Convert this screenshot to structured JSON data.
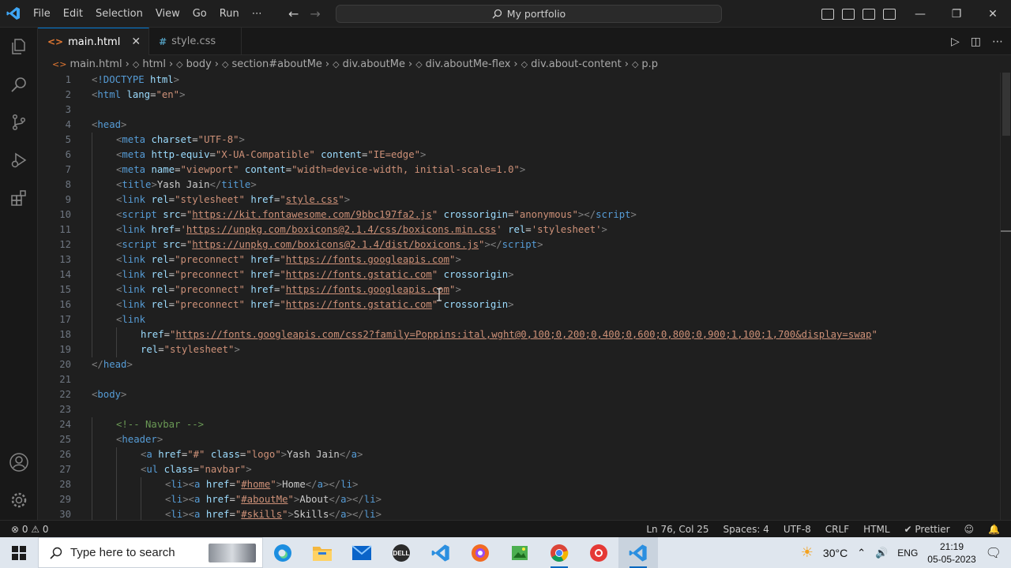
{
  "titlebar": {
    "menu": [
      "File",
      "Edit",
      "Selection",
      "View",
      "Go",
      "Run",
      "⋯"
    ],
    "command_center": "My portfolio",
    "window_controls": [
      "—",
      "❐",
      "✕"
    ]
  },
  "tabs": [
    {
      "label": "main.html",
      "icon": "html-file-icon",
      "active": true,
      "icon_glyph": "<>"
    },
    {
      "label": "style.css",
      "icon": "css-file-icon",
      "active": false,
      "icon_glyph": "#"
    }
  ],
  "breadcrumb": [
    "main.html",
    "html",
    "body",
    "section#aboutMe",
    "div.aboutMe",
    "div.aboutMe-flex",
    "div.about-content",
    "p.p"
  ],
  "code": {
    "lines": [
      {
        "n": "1",
        "indent": 0,
        "tokens": [
          [
            "br",
            "<"
          ],
          [
            "tag",
            "!DOCTYPE"
          ],
          [
            "txt",
            " "
          ],
          [
            "attr",
            "html"
          ],
          [
            "br",
            ">"
          ]
        ]
      },
      {
        "n": "2",
        "indent": 0,
        "tokens": [
          [
            "br",
            "<"
          ],
          [
            "tag",
            "html"
          ],
          [
            "txt",
            " "
          ],
          [
            "attr",
            "lang"
          ],
          [
            "eq",
            "="
          ],
          [
            "str",
            "\"en\""
          ],
          [
            "br",
            ">"
          ]
        ]
      },
      {
        "n": "3",
        "indent": 0,
        "tokens": []
      },
      {
        "n": "4",
        "indent": 0,
        "tokens": [
          [
            "br",
            "<"
          ],
          [
            "tag",
            "head"
          ],
          [
            "br",
            ">"
          ]
        ]
      },
      {
        "n": "5",
        "indent": 1,
        "tokens": [
          [
            "br",
            "<"
          ],
          [
            "tag",
            "meta"
          ],
          [
            "txt",
            " "
          ],
          [
            "attr",
            "charset"
          ],
          [
            "eq",
            "="
          ],
          [
            "str",
            "\"UTF-8\""
          ],
          [
            "br",
            ">"
          ]
        ]
      },
      {
        "n": "6",
        "indent": 1,
        "tokens": [
          [
            "br",
            "<"
          ],
          [
            "tag",
            "meta"
          ],
          [
            "txt",
            " "
          ],
          [
            "attr",
            "http-equiv"
          ],
          [
            "eq",
            "="
          ],
          [
            "str",
            "\"X-UA-Compatible\""
          ],
          [
            "txt",
            " "
          ],
          [
            "attr",
            "content"
          ],
          [
            "eq",
            "="
          ],
          [
            "str",
            "\"IE=edge\""
          ],
          [
            "br",
            ">"
          ]
        ]
      },
      {
        "n": "7",
        "indent": 1,
        "tokens": [
          [
            "br",
            "<"
          ],
          [
            "tag",
            "meta"
          ],
          [
            "txt",
            " "
          ],
          [
            "attr",
            "name"
          ],
          [
            "eq",
            "="
          ],
          [
            "str",
            "\"viewport\""
          ],
          [
            "txt",
            " "
          ],
          [
            "attr",
            "content"
          ],
          [
            "eq",
            "="
          ],
          [
            "str",
            "\"width=device-width, initial-scale=1.0\""
          ],
          [
            "br",
            ">"
          ]
        ]
      },
      {
        "n": "8",
        "indent": 1,
        "tokens": [
          [
            "br",
            "<"
          ],
          [
            "tag",
            "title"
          ],
          [
            "br",
            ">"
          ],
          [
            "txt",
            "Yash Jain"
          ],
          [
            "br",
            "</"
          ],
          [
            "tag",
            "title"
          ],
          [
            "br",
            ">"
          ]
        ]
      },
      {
        "n": "9",
        "indent": 1,
        "tokens": [
          [
            "br",
            "<"
          ],
          [
            "tag",
            "link"
          ],
          [
            "txt",
            " "
          ],
          [
            "attr",
            "rel"
          ],
          [
            "eq",
            "="
          ],
          [
            "str",
            "\"stylesheet\""
          ],
          [
            "txt",
            " "
          ],
          [
            "attr",
            "href"
          ],
          [
            "eq",
            "="
          ],
          [
            "str",
            "\""
          ],
          [
            "strlink",
            "style.css"
          ],
          [
            "str",
            "\""
          ],
          [
            "br",
            ">"
          ]
        ]
      },
      {
        "n": "10",
        "indent": 1,
        "tokens": [
          [
            "br",
            "<"
          ],
          [
            "tag",
            "script"
          ],
          [
            "txt",
            " "
          ],
          [
            "attr",
            "src"
          ],
          [
            "eq",
            "="
          ],
          [
            "str",
            "\""
          ],
          [
            "strlink",
            "https://kit.fontawesome.com/9bbc197fa2.js"
          ],
          [
            "str",
            "\""
          ],
          [
            "txt",
            " "
          ],
          [
            "attr",
            "crossorigin"
          ],
          [
            "eq",
            "="
          ],
          [
            "str",
            "\"anonymous\""
          ],
          [
            "br",
            "></"
          ],
          [
            "tag",
            "script"
          ],
          [
            "br",
            ">"
          ]
        ]
      },
      {
        "n": "11",
        "indent": 1,
        "tokens": [
          [
            "br",
            "<"
          ],
          [
            "tag",
            "link"
          ],
          [
            "txt",
            " "
          ],
          [
            "attr",
            "href"
          ],
          [
            "eq",
            "="
          ],
          [
            "str",
            "'"
          ],
          [
            "strlink",
            "https://unpkg.com/boxicons@2.1.4/css/boxicons.min.css"
          ],
          [
            "str",
            "'"
          ],
          [
            "txt",
            " "
          ],
          [
            "attr",
            "rel"
          ],
          [
            "eq",
            "="
          ],
          [
            "str",
            "'stylesheet'"
          ],
          [
            "br",
            ">"
          ]
        ]
      },
      {
        "n": "12",
        "indent": 1,
        "tokens": [
          [
            "br",
            "<"
          ],
          [
            "tag",
            "script"
          ],
          [
            "txt",
            " "
          ],
          [
            "attr",
            "src"
          ],
          [
            "eq",
            "="
          ],
          [
            "str",
            "\""
          ],
          [
            "strlink",
            "https://unpkg.com/boxicons@2.1.4/dist/boxicons.js"
          ],
          [
            "str",
            "\""
          ],
          [
            "br",
            "></"
          ],
          [
            "tag",
            "script"
          ],
          [
            "br",
            ">"
          ]
        ]
      },
      {
        "n": "13",
        "indent": 1,
        "tokens": [
          [
            "br",
            "<"
          ],
          [
            "tag",
            "link"
          ],
          [
            "txt",
            " "
          ],
          [
            "attr",
            "rel"
          ],
          [
            "eq",
            "="
          ],
          [
            "str",
            "\"preconnect\""
          ],
          [
            "txt",
            " "
          ],
          [
            "attr",
            "href"
          ],
          [
            "eq",
            "="
          ],
          [
            "str",
            "\""
          ],
          [
            "strlink",
            "https://fonts.googleapis.com"
          ],
          [
            "str",
            "\""
          ],
          [
            "br",
            ">"
          ]
        ]
      },
      {
        "n": "14",
        "indent": 1,
        "tokens": [
          [
            "br",
            "<"
          ],
          [
            "tag",
            "link"
          ],
          [
            "txt",
            " "
          ],
          [
            "attr",
            "rel"
          ],
          [
            "eq",
            "="
          ],
          [
            "str",
            "\"preconnect\""
          ],
          [
            "txt",
            " "
          ],
          [
            "attr",
            "href"
          ],
          [
            "eq",
            "="
          ],
          [
            "str",
            "\""
          ],
          [
            "strlink",
            "https://fonts.gstatic.com"
          ],
          [
            "str",
            "\""
          ],
          [
            "txt",
            " "
          ],
          [
            "attr",
            "crossorigin"
          ],
          [
            "br",
            ">"
          ]
        ]
      },
      {
        "n": "15",
        "indent": 1,
        "tokens": [
          [
            "br",
            "<"
          ],
          [
            "tag",
            "link"
          ],
          [
            "txt",
            " "
          ],
          [
            "attr",
            "rel"
          ],
          [
            "eq",
            "="
          ],
          [
            "str",
            "\"preconnect\""
          ],
          [
            "txt",
            " "
          ],
          [
            "attr",
            "href"
          ],
          [
            "eq",
            "="
          ],
          [
            "str",
            "\""
          ],
          [
            "strlink",
            "https://fonts.googleapis.com"
          ],
          [
            "str",
            "\""
          ],
          [
            "br",
            ">"
          ]
        ]
      },
      {
        "n": "16",
        "indent": 1,
        "tokens": [
          [
            "br",
            "<"
          ],
          [
            "tag",
            "link"
          ],
          [
            "txt",
            " "
          ],
          [
            "attr",
            "rel"
          ],
          [
            "eq",
            "="
          ],
          [
            "str",
            "\"preconnect\""
          ],
          [
            "txt",
            " "
          ],
          [
            "attr",
            "href"
          ],
          [
            "eq",
            "="
          ],
          [
            "str",
            "\""
          ],
          [
            "strlink",
            "https://fonts.gstatic.com"
          ],
          [
            "str",
            "\""
          ],
          [
            "txt",
            " "
          ],
          [
            "attr",
            "crossorigin"
          ],
          [
            "br",
            ">"
          ]
        ]
      },
      {
        "n": "17",
        "indent": 1,
        "tokens": [
          [
            "br",
            "<"
          ],
          [
            "tag",
            "link"
          ]
        ]
      },
      {
        "n": "18",
        "indent": 2,
        "tokens": [
          [
            "attr",
            "href"
          ],
          [
            "eq",
            "="
          ],
          [
            "str",
            "\""
          ],
          [
            "strlink",
            "https://fonts.googleapis.com/css2?family=Poppins:ital,wght@0,100;0,200;0,400;0,600;0,800;0,900;1,100;1,700&display=swap"
          ],
          [
            "str",
            "\""
          ]
        ]
      },
      {
        "n": "19",
        "indent": 2,
        "tokens": [
          [
            "attr",
            "rel"
          ],
          [
            "eq",
            "="
          ],
          [
            "str",
            "\"stylesheet\""
          ],
          [
            "br",
            ">"
          ]
        ]
      },
      {
        "n": "20",
        "indent": 0,
        "tokens": [
          [
            "br",
            "</"
          ],
          [
            "tag",
            "head"
          ],
          [
            "br",
            ">"
          ]
        ]
      },
      {
        "n": "21",
        "indent": 0,
        "tokens": []
      },
      {
        "n": "22",
        "indent": 0,
        "tokens": [
          [
            "br",
            "<"
          ],
          [
            "tag",
            "body"
          ],
          [
            "br",
            ">"
          ]
        ]
      },
      {
        "n": "23",
        "indent": 0,
        "tokens": []
      },
      {
        "n": "24",
        "indent": 1,
        "tokens": [
          [
            "com",
            "<!-- Navbar -->"
          ]
        ]
      },
      {
        "n": "25",
        "indent": 1,
        "tokens": [
          [
            "br",
            "<"
          ],
          [
            "tag",
            "header"
          ],
          [
            "br",
            ">"
          ]
        ]
      },
      {
        "n": "26",
        "indent": 2,
        "tokens": [
          [
            "br",
            "<"
          ],
          [
            "tag",
            "a"
          ],
          [
            "txt",
            " "
          ],
          [
            "attr",
            "href"
          ],
          [
            "eq",
            "="
          ],
          [
            "str",
            "\"#\""
          ],
          [
            "txt",
            " "
          ],
          [
            "attr",
            "class"
          ],
          [
            "eq",
            "="
          ],
          [
            "str",
            "\"logo\""
          ],
          [
            "br",
            ">"
          ],
          [
            "txt",
            "Yash Jain"
          ],
          [
            "br",
            "</"
          ],
          [
            "tag",
            "a"
          ],
          [
            "br",
            ">"
          ]
        ]
      },
      {
        "n": "27",
        "indent": 2,
        "tokens": [
          [
            "br",
            "<"
          ],
          [
            "tag",
            "ul"
          ],
          [
            "txt",
            " "
          ],
          [
            "attr",
            "class"
          ],
          [
            "eq",
            "="
          ],
          [
            "str",
            "\"navbar\""
          ],
          [
            "br",
            ">"
          ]
        ]
      },
      {
        "n": "28",
        "indent": 3,
        "tokens": [
          [
            "br",
            "<"
          ],
          [
            "tag",
            "li"
          ],
          [
            "br",
            "><"
          ],
          [
            "tag",
            "a"
          ],
          [
            "txt",
            " "
          ],
          [
            "attr",
            "href"
          ],
          [
            "eq",
            "="
          ],
          [
            "str",
            "\""
          ],
          [
            "strlink",
            "#home"
          ],
          [
            "str",
            "\""
          ],
          [
            "br",
            ">"
          ],
          [
            "txt",
            "Home"
          ],
          [
            "br",
            "</"
          ],
          [
            "tag",
            "a"
          ],
          [
            "br",
            "></"
          ],
          [
            "tag",
            "li"
          ],
          [
            "br",
            ">"
          ]
        ]
      },
      {
        "n": "29",
        "indent": 3,
        "tokens": [
          [
            "br",
            "<"
          ],
          [
            "tag",
            "li"
          ],
          [
            "br",
            "><"
          ],
          [
            "tag",
            "a"
          ],
          [
            "txt",
            " "
          ],
          [
            "attr",
            "href"
          ],
          [
            "eq",
            "="
          ],
          [
            "str",
            "\""
          ],
          [
            "strlink",
            "#aboutMe"
          ],
          [
            "str",
            "\""
          ],
          [
            "br",
            ">"
          ],
          [
            "txt",
            "About"
          ],
          [
            "br",
            "</"
          ],
          [
            "tag",
            "a"
          ],
          [
            "br",
            "></"
          ],
          [
            "tag",
            "li"
          ],
          [
            "br",
            ">"
          ]
        ]
      },
      {
        "n": "30",
        "indent": 3,
        "tokens": [
          [
            "br",
            "<"
          ],
          [
            "tag",
            "li"
          ],
          [
            "br",
            "><"
          ],
          [
            "tag",
            "a"
          ],
          [
            "txt",
            " "
          ],
          [
            "attr",
            "href"
          ],
          [
            "eq",
            "="
          ],
          [
            "str",
            "\""
          ],
          [
            "strlink",
            "#skills"
          ],
          [
            "str",
            "\""
          ],
          [
            "br",
            ">"
          ],
          [
            "txt",
            "Skills"
          ],
          [
            "br",
            "</"
          ],
          [
            "tag",
            "a"
          ],
          [
            "br",
            "></"
          ],
          [
            "tag",
            "li"
          ],
          [
            "br",
            ">"
          ]
        ]
      }
    ]
  },
  "statusbar": {
    "errors": "⊗ 0 ⚠ 0",
    "position": "Ln 76, Col 25",
    "spaces": "Spaces: 4",
    "encoding": "UTF-8",
    "eol": "CRLF",
    "language": "HTML",
    "formatter": "✔ Prettier"
  },
  "taskbar": {
    "search_placeholder": "Type here to search",
    "weather": "30°C",
    "lang": "ENG",
    "time": "21:19",
    "date": "05-05-2023"
  },
  "colors": {
    "accent": "#0078d4",
    "tag": "#569cd6",
    "attr": "#9cdcfe",
    "string": "#ce9178",
    "comment": "#6a9955"
  }
}
